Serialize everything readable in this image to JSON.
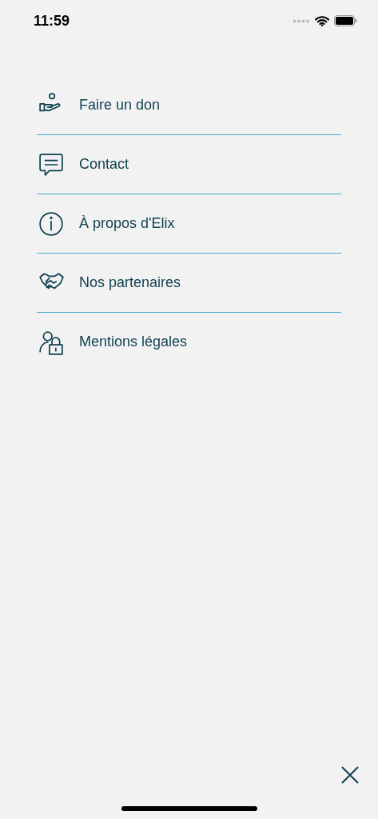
{
  "status_bar": {
    "time": "11:59"
  },
  "menu": {
    "items": [
      {
        "kind": "donate",
        "label": "Faire un don"
      },
      {
        "kind": "contact",
        "label": "Contact"
      },
      {
        "kind": "about",
        "label": "À propos d'Elix"
      },
      {
        "kind": "partners",
        "label": "Nos partenaires"
      },
      {
        "kind": "legal",
        "label": "Mentions légales"
      }
    ]
  }
}
